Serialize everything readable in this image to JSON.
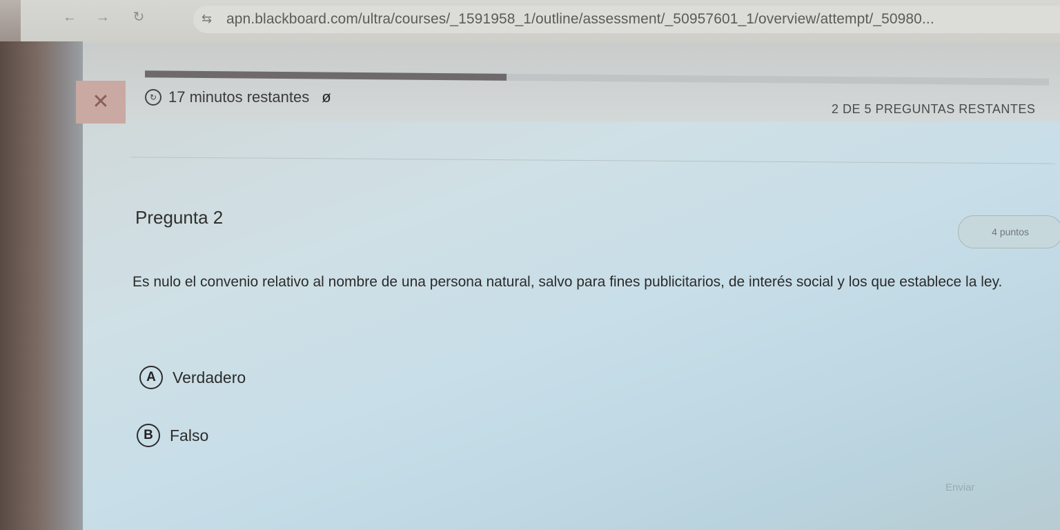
{
  "browser": {
    "back_icon": "back-arrow-icon",
    "forward_icon": "forward-arrow-icon",
    "reload_icon": "reload-icon",
    "site_settings_icon": "site-settings-icon",
    "url": "apn.blackboard.com/ultra/courses/_1591958_1/outline/assessment/_50957601_1/overview/attempt/_50980..."
  },
  "assessment": {
    "progress_fraction": 0.4,
    "timer_text": "17 minutos restantes",
    "counter_text": "2 DE 5 PREGUNTAS RESTANTES",
    "question_title": "Pregunta 2",
    "points_label": "4 puntos",
    "question_text": "Es nulo el convenio relativo al nombre de una persona natural, salvo para fines publicitarios, de interés social y los que establece la ley.",
    "answers": [
      {
        "letter": "A",
        "label": "Verdadero"
      },
      {
        "letter": "B",
        "label": "Falso"
      }
    ],
    "footer_button": "Enviar"
  }
}
